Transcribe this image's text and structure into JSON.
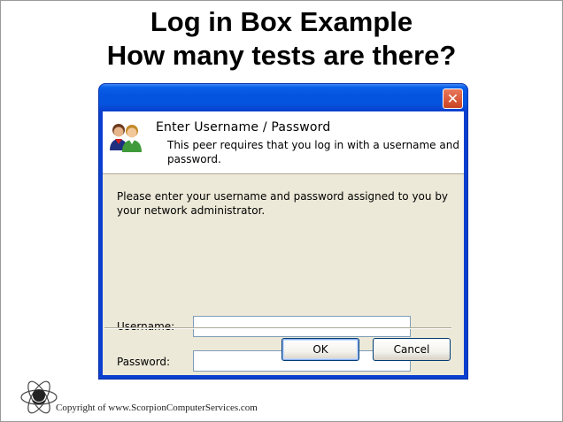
{
  "slide": {
    "title_line1": "Log in Box Example",
    "title_line2": "How many tests are there?",
    "footer": "Copyright of www.ScorpionComputerServices.com"
  },
  "dialog": {
    "close_icon": "close-x-icon",
    "header_icon": "users-icon",
    "header_title": "Enter Username / Password",
    "header_desc": "This peer requires that you log in with a username and password.",
    "instructions": "Please enter your username and password assigned to you by your network administrator.",
    "username_label": "Username:",
    "username_value": "",
    "password_label": "Password:",
    "password_value": "",
    "ok_label": "OK",
    "cancel_label": "Cancel"
  },
  "colors": {
    "titlebar": "#0a5fe8",
    "dialog_body": "#ece9d8",
    "close_button": "#d9562f"
  }
}
